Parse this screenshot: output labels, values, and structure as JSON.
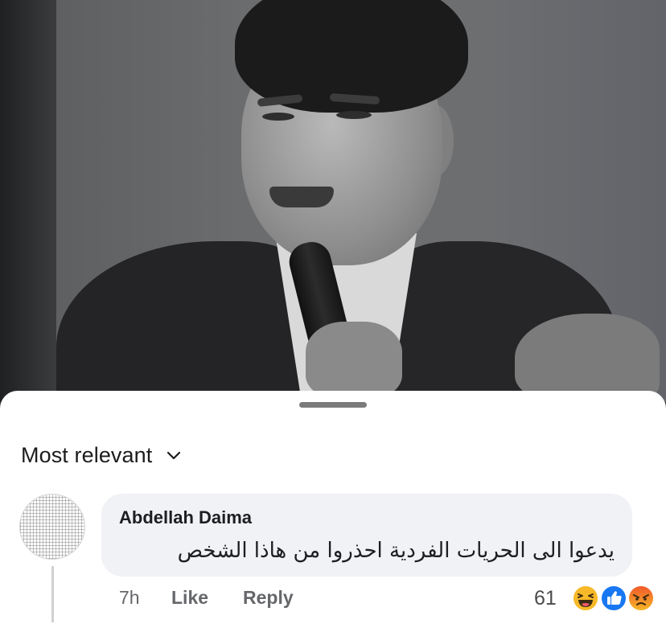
{
  "sheet": {
    "sort_label": "Most relevant"
  },
  "comment": {
    "author": "Abdellah Daima",
    "text": "يدعوا الى الحريات الفردية احذروا من هاذا الشخص",
    "time": "7h",
    "like_label": "Like",
    "reply_label": "Reply",
    "reaction_count": "61",
    "reactions": [
      "haha",
      "like",
      "angry"
    ]
  },
  "colors": {
    "like_blue": "#1877f2",
    "haha_yellow": "#f7b928",
    "angry_orange": "#e9710f",
    "meta_gray": "#65676b",
    "bubble_bg": "#f0f2f5"
  }
}
